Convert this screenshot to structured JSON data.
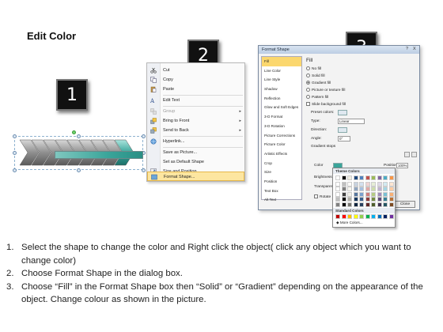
{
  "title": "Edit Color",
  "badges": [
    "1",
    "2",
    "3"
  ],
  "context_menu": {
    "items": [
      {
        "label": "Cut",
        "icon": "scissors-icon",
        "key": "t"
      },
      {
        "label": "Copy",
        "icon": "copy-icon"
      },
      {
        "label": "Paste",
        "icon": "paste-icon"
      },
      {
        "label": "Edit Text",
        "icon": "edit-text-icon"
      },
      {
        "label": "Group",
        "icon": "group-icon",
        "disabled": true,
        "submenu": true
      },
      {
        "label": "Bring to Front",
        "icon": "bring-front-icon",
        "submenu": true
      },
      {
        "label": "Send to Back",
        "icon": "send-back-icon",
        "submenu": true
      },
      {
        "label": "Hyperlink...",
        "icon": "hyperlink-icon"
      },
      {
        "label": "Save as Picture...",
        "icon": ""
      },
      {
        "label": "Set as Default Shape",
        "icon": ""
      },
      {
        "label": "Size and Position...",
        "icon": "size-icon"
      },
      {
        "label": "Format Shape...",
        "icon": "format-shape-icon",
        "highlighted": true
      }
    ]
  },
  "dialog": {
    "title": "Format Shape",
    "controls": [
      "?",
      "X"
    ],
    "sidebar": [
      "Fill",
      "Line Color",
      "Line Style",
      "Shadow",
      "Reflection",
      "Glow and Soft Edges",
      "3-D Format",
      "3-D Rotation",
      "Picture Corrections",
      "Picture Color",
      "Artistic Effects",
      "Crop",
      "Size",
      "Position",
      "Text Box",
      "Alt Text"
    ],
    "fill_heading": "Fill",
    "options": [
      {
        "label": "No fill",
        "type": "radio",
        "checked": false
      },
      {
        "label": "Solid fill",
        "type": "radio",
        "checked": false
      },
      {
        "label": "Gradient fill",
        "type": "radio",
        "checked": true
      },
      {
        "label": "Picture or texture fill",
        "type": "radio",
        "checked": false
      },
      {
        "label": "Pattern fill",
        "type": "radio",
        "checked": false
      },
      {
        "label": "Slide background fill",
        "type": "checkbox",
        "checked": false
      }
    ],
    "preset_label": "Preset colors:",
    "type_label": "Type:",
    "type_value": "Linear",
    "direction_label": "Direction:",
    "angle_label": "Angle:",
    "angle_value": "0°",
    "stops_label": "Gradient stops",
    "color_label": "Color",
    "position_label": "Position:",
    "position_value": "100%",
    "brightness_label": "Brightness:",
    "transparency_label": "Transparen",
    "rotate_label": "Rotate",
    "close_label": "Close",
    "accent": "#3aa59a"
  },
  "color_popup": {
    "theme_label": "Theme Colors",
    "standard_label": "Standard Colors",
    "more_label": "More Colors...",
    "theme_top": [
      "#ffffff",
      "#000000",
      "#eeece1",
      "#1f497d",
      "#4f81bd",
      "#c0504d",
      "#9bbb59",
      "#8064a2",
      "#4bacc6",
      "#f79646"
    ],
    "standard": [
      "#c00000",
      "#ff0000",
      "#ffc000",
      "#ffff00",
      "#92d050",
      "#00b050",
      "#00b0f0",
      "#0070c0",
      "#002060",
      "#7030a0"
    ]
  },
  "steps": [
    "Select the shape to change the color and Right click the object( click any object which you want to change color)",
    "Choose Format Shape in the dialog box.",
    "Choose “Fill” in the Format Shape box then “Solid” or “Gradient” depending on the appearance of the object. Change colour as shown in the picture."
  ],
  "step_numbers": [
    "1.",
    "2.",
    "3."
  ]
}
